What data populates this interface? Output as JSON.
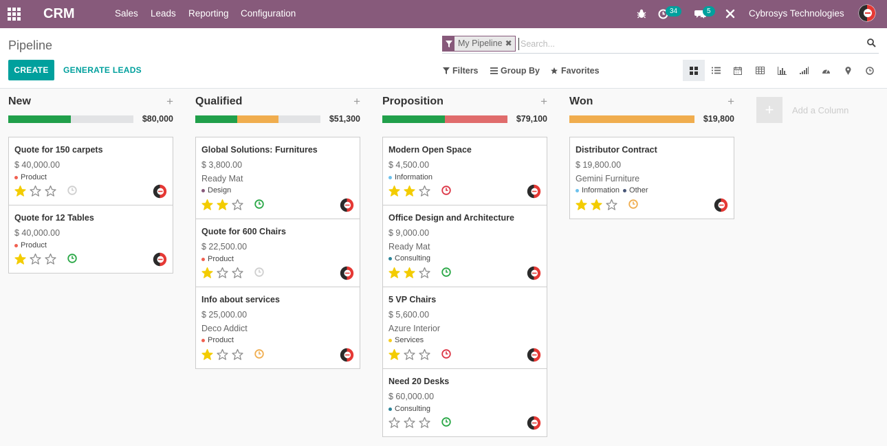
{
  "navbar": {
    "brand": "CRM",
    "menu": [
      "Sales",
      "Leads",
      "Reporting",
      "Configuration"
    ],
    "activity_count": "34",
    "messages_count": "5",
    "company": "Cybrosys Technologies"
  },
  "control_panel": {
    "breadcrumb": "Pipeline",
    "create_label": "CREATE",
    "generate_label": "GENERATE LEADS",
    "facet_label": "My Pipeline",
    "search_placeholder": "Search...",
    "filters_label": "Filters",
    "groupby_label": "Group By",
    "favorites_label": "Favorites",
    "views": [
      "kanban-icon",
      "list-icon",
      "calendar-icon",
      "pivot-icon",
      "graph-icon",
      "cohort-icon",
      "dashboard-icon",
      "map-icon",
      "activity-icon"
    ],
    "active_view": "kanban-icon"
  },
  "columns": [
    {
      "title": "New",
      "total": "$80,000",
      "progress": [
        {
          "color": "#21a04b",
          "fraction": 0.5
        }
      ],
      "cards": [
        {
          "title": "Quote for 150 carpets",
          "amount": "$ 40,000.00",
          "company": "",
          "tags": [
            {
              "label": "Product",
              "color": "#f06050"
            }
          ],
          "stars": 1,
          "activity": "none"
        },
        {
          "title": "Quote for 12 Tables",
          "amount": "$ 40,000.00",
          "company": "",
          "tags": [
            {
              "label": "Product",
              "color": "#f06050"
            }
          ],
          "stars": 1,
          "activity": "ok"
        }
      ]
    },
    {
      "title": "Qualified",
      "total": "$51,300",
      "progress": [
        {
          "color": "#21a04b",
          "fraction": 0.333
        },
        {
          "color": "#f0ad4e",
          "fraction": 0.334
        }
      ],
      "cards": [
        {
          "title": "Global Solutions: Furnitures",
          "amount": "$ 3,800.00",
          "company": "Ready Mat",
          "tags": [
            {
              "label": "Design",
              "color": "#875a7b"
            }
          ],
          "stars": 2,
          "activity": "ok"
        },
        {
          "title": "Quote for 600 Chairs",
          "amount": "$ 22,500.00",
          "company": "",
          "tags": [
            {
              "label": "Product",
              "color": "#f06050"
            }
          ],
          "stars": 1,
          "activity": "none"
        },
        {
          "title": "Info about services",
          "amount": "$ 25,000.00",
          "company": "Deco Addict",
          "tags": [
            {
              "label": "Product",
              "color": "#f06050"
            }
          ],
          "stars": 1,
          "activity": "warning"
        }
      ]
    },
    {
      "title": "Proposition",
      "total": "$79,100",
      "progress": [
        {
          "color": "#21a04b",
          "fraction": 0.5
        },
        {
          "color": "#e06c6c",
          "fraction": 0.5
        }
      ],
      "cards": [
        {
          "title": "Modern Open Space",
          "amount": "$ 4,500.00",
          "company": "",
          "tags": [
            {
              "label": "Information",
              "color": "#6cc1ed"
            }
          ],
          "stars": 2,
          "activity": "danger"
        },
        {
          "title": "Office Design and Architecture",
          "amount": "$ 9,000.00",
          "company": "Ready Mat",
          "tags": [
            {
              "label": "Consulting",
              "color": "#2c8397"
            }
          ],
          "stars": 2,
          "activity": "ok"
        },
        {
          "title": "5 VP Chairs",
          "amount": "$ 5,600.00",
          "company": "Azure Interior",
          "tags": [
            {
              "label": "Services",
              "color": "#f7cd1f"
            }
          ],
          "stars": 1,
          "activity": "danger"
        },
        {
          "title": "Need 20 Desks",
          "amount": "$ 60,000.00",
          "company": "",
          "tags": [
            {
              "label": "Consulting",
              "color": "#2c8397"
            }
          ],
          "stars": 0,
          "activity": "ok"
        }
      ]
    },
    {
      "title": "Won",
      "total": "$19,800",
      "progress": [
        {
          "color": "#f0ad4e",
          "fraction": 1.0
        }
      ],
      "cards": [
        {
          "title": "Distributor Contract",
          "amount": "$ 19,800.00",
          "company": "Gemini Furniture",
          "tags": [
            {
              "label": "Information",
              "color": "#6cc1ed"
            },
            {
              "label": "Other",
              "color": "#475577"
            }
          ],
          "stars": 2,
          "activity": "warning"
        }
      ]
    }
  ],
  "add_column": {
    "plus": "+",
    "label": "Add a Column"
  },
  "colors": {
    "brand": "#875a7b",
    "accent": "#00a09d",
    "star": "#f3cc00",
    "activity_ok": "#28a745",
    "activity_warning": "#f0ad4e",
    "activity_danger": "#dc3545",
    "activity_none": "#cfcfcf"
  }
}
